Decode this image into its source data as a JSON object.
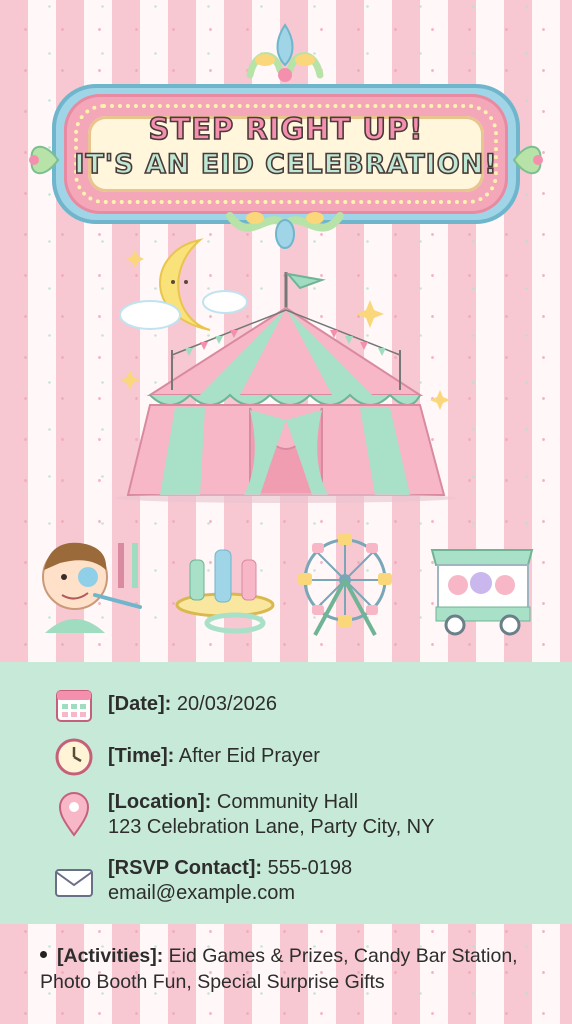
{
  "banner": {
    "line1": "STEP RIGHT UP!",
    "line2": "IT'S AN EID CELEBRATION!"
  },
  "icons": {
    "crest": "ornament-icon",
    "moon": "crescent-moon-icon",
    "tent": "circus-tent-icon",
    "face_paint": "face-painting-icon",
    "ring_toss": "ring-toss-icon",
    "ferris_wheel": "ferris-wheel-icon",
    "cotton_candy": "cotton-candy-cart-icon",
    "calendar": "calendar-icon",
    "clock": "clock-icon",
    "location": "location-pin-icon",
    "mail": "envelope-icon"
  },
  "details": {
    "date_label": "[Date]:",
    "date_value": "20/03/2026",
    "time_label": "[Time]:",
    "time_value": "After Eid Prayer",
    "location_label": "[Location]:",
    "location_value": "Community Hall",
    "location_address": "123 Celebration Lane, Party City, NY",
    "rsvp_label": "[RSVP Contact]:",
    "rsvp_phone": "555-0198",
    "rsvp_email": "email@example.com"
  },
  "activities": {
    "label": "[Activities]:",
    "value": "Eid Games & Prizes, Candy Bar Station, Photo Booth Fun, Special Surprise Gifts"
  },
  "colors": {
    "pink": "#f7c7d2",
    "mint": "#c7ead8",
    "blue": "#9fd5e6",
    "cream": "#fff6dc"
  }
}
